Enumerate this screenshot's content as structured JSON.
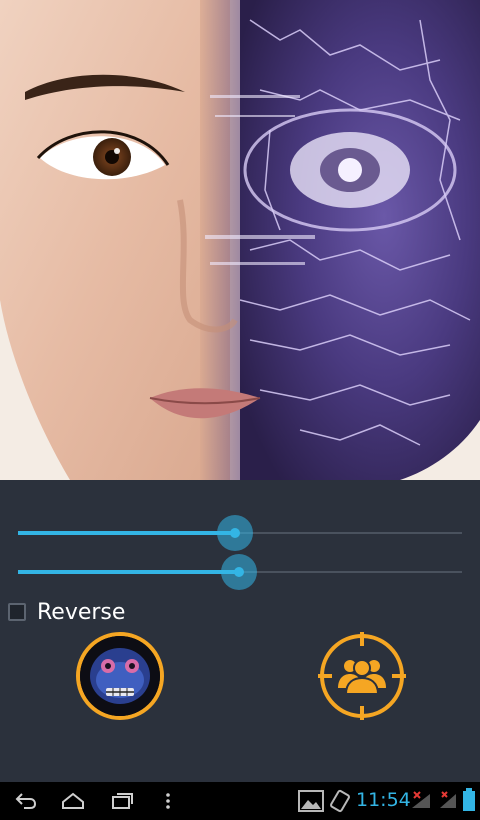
{
  "controls": {
    "slider1": {
      "value_percent": 48.9
    },
    "slider2": {
      "value_percent": 49.8
    },
    "reverse": {
      "label": "Reverse",
      "checked": false
    }
  },
  "buttons": {
    "avatar": "mask-avatar-icon",
    "target": "group-target-icon"
  },
  "colors": {
    "accent": "#33b5e5",
    "orange": "#f5a623",
    "panel": "#2b313c",
    "navbar": "#000000"
  },
  "statusbar": {
    "time": "11:54"
  }
}
